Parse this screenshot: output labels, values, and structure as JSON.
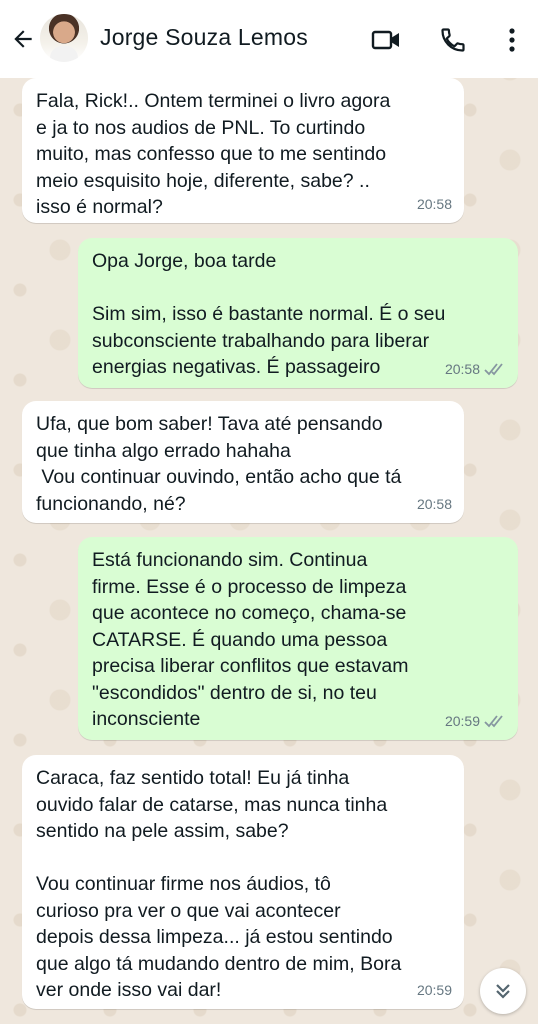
{
  "header": {
    "contact_name": "Jorge Souza Lemos",
    "icons": [
      "back-arrow-icon",
      "video-call-icon",
      "phone-icon",
      "more-vertical-icon"
    ]
  },
  "messages": [
    {
      "direction": "incoming",
      "text": "Fala, Rick!.. Ontem terminei o livro agora\ne ja to nos audios de PNL. To curtindo\nmuito, mas confesso que to me sentindo\nmeio esquisito hoje, diferente, sabe? ..\nisso é normal?",
      "time": "20:58"
    },
    {
      "direction": "outgoing",
      "text": "Opa Jorge, boa tarde\n\nSim sim, isso é bastante normal. É o seu\nsubconsciente trabalhando para liberar\nenergias negativas. É passageiro",
      "time": "20:58",
      "status": "read"
    },
    {
      "direction": "incoming",
      "text": "Ufa, que bom saber! Tava até pensando\nque tinha algo errado hahaha\n Vou continuar ouvindo, então acho que tá\nfuncionando, né?",
      "time": "20:58"
    },
    {
      "direction": "outgoing",
      "text": "Está funcionando sim. Continua\nfirme. Esse é o processo de limpeza\nque acontece no começo, chama-se\nCATARSE. É quando uma pessoa\nprecisa liberar conflitos que estavam\n\"escondidos\" dentro de si, no teu\ninconsciente",
      "time": "20:59",
      "status": "read"
    },
    {
      "direction": "incoming",
      "text": "Caraca, faz sentido total! Eu já tinha\nouvido falar de catarse, mas nunca tinha\nsentido na pele assim, sabe?\n\nVou continuar firme nos áudios, tô\ncurioso pra ver o que vai acontecer\ndepois dessa limpeza... já estou sentindo\nque algo tá mudando dentro de mim, Bora\nver onde isso vai dar!",
      "time": "20:59"
    }
  ],
  "colors": {
    "incoming_bubble": "#ffffff",
    "outgoing_bubble": "#d9fdd3",
    "chat_background": "#efe7dd",
    "timestamp": "#667781",
    "read_ticks": "#8696a0"
  }
}
